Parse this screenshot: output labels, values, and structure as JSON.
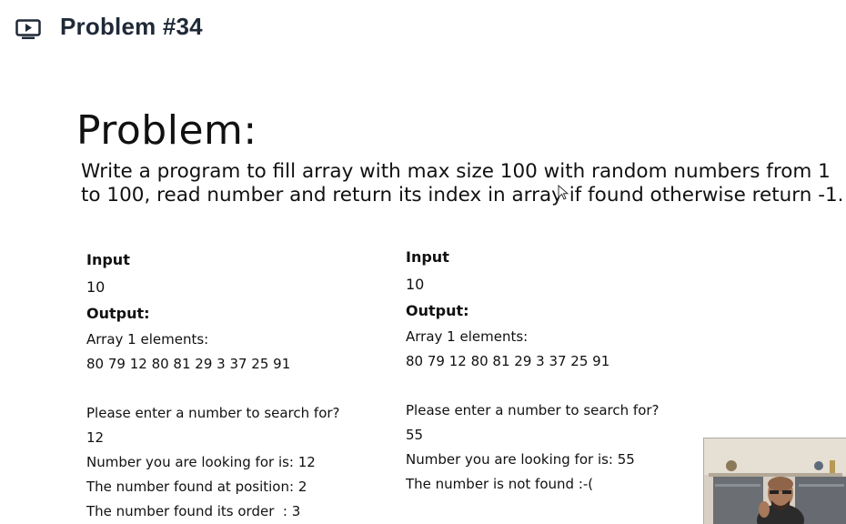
{
  "header": {
    "title": "Problem #34",
    "icon": "play-video-icon"
  },
  "slide": {
    "heading": "Problem:",
    "statement": "Write a program to fill array with max size 100 with random numbers from 1 to 100, read number and return its index in array if found otherwise return -1."
  },
  "examples": [
    {
      "input_label": "Input",
      "input_value": "10",
      "output_label": "Output:",
      "array_label": "Array 1 elements:",
      "array_values": "80 79 12 80 81 29 3 37 25 91",
      "prompt": "Please enter a number to search for?",
      "entered": "12",
      "looking_for": "Number you are looking for is: 12",
      "result_1": "The number found at position: 2",
      "result_2": "The number found its order  : 3"
    },
    {
      "input_label": "Input",
      "input_value": "10",
      "output_label": "Output:",
      "array_label": "Array 1 elements:",
      "array_values": "80 79 12 80 81 29 3 37 25 91",
      "prompt": "Please enter a number to search for?",
      "entered": "55",
      "looking_for": "Number you are looking for is: 55",
      "result_1": "The number is not found :-("
    }
  ]
}
